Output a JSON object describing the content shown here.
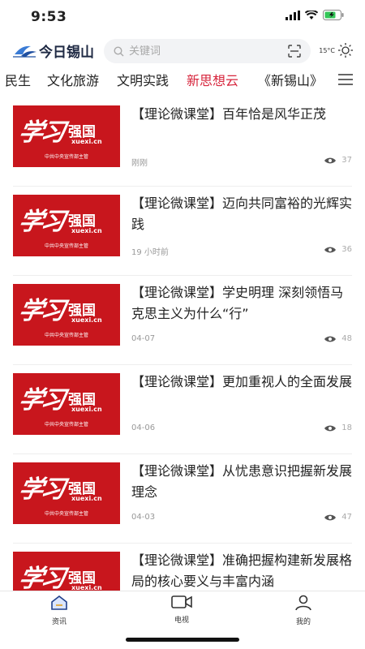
{
  "status_bar": {
    "time": "9:53"
  },
  "header": {
    "app_name": "今日锡山",
    "search_placeholder": "关键词",
    "temperature": "15°C"
  },
  "tabs": [
    {
      "label": "民生",
      "active": false
    },
    {
      "label": "文化旅游",
      "active": false
    },
    {
      "label": "文明实践",
      "active": false
    },
    {
      "label": "新思想云",
      "active": true
    },
    {
      "label": "《新锡山》",
      "active": false
    }
  ],
  "thumbnail": {
    "cursive_text": "学习",
    "brand_text": "强国",
    "url_text": "xuexi.cn",
    "sub_text": "中共中央宣传部主管"
  },
  "articles": [
    {
      "title": "【理论微课堂】百年恰是风华正茂",
      "time": "刚刚",
      "views": "37"
    },
    {
      "title": "【理论微课堂】迈向共同富裕的光辉实践",
      "time": "19 小时前",
      "views": "36"
    },
    {
      "title": "【理论微课堂】学史明理 深刻领悟马克思主义为什么“行”",
      "time": "04-07",
      "views": "48"
    },
    {
      "title": "【理论微课堂】更加重视人的全面发展",
      "time": "04-06",
      "views": "18"
    },
    {
      "title": "【理论微课堂】从忧患意识把握新发展理念",
      "time": "04-03",
      "views": "47"
    },
    {
      "title": "【理论微课堂】准确把握构建新发展格局的核心要义与丰富内涵",
      "time": "",
      "views": ""
    }
  ],
  "bottom_nav": [
    {
      "label": "资讯",
      "icon": "home-icon"
    },
    {
      "label": "电视",
      "icon": "tv-camera-icon"
    },
    {
      "label": "我的",
      "icon": "person-icon"
    }
  ],
  "colors": {
    "accent": "#d7263d",
    "thumb_red": "#c8161d"
  }
}
